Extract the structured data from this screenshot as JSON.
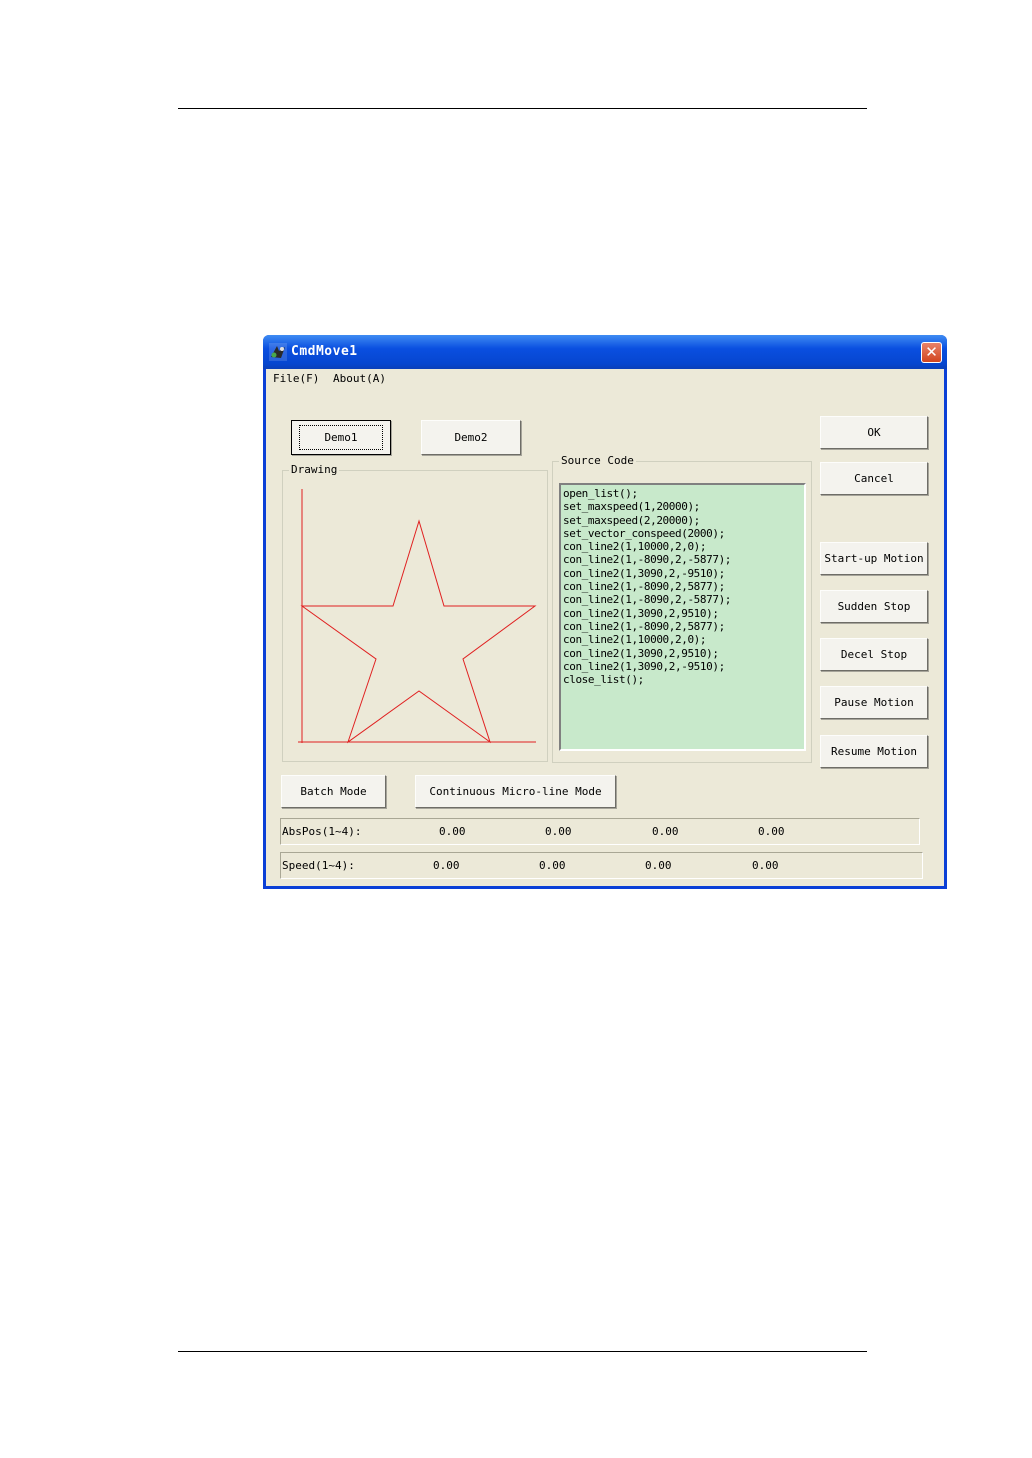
{
  "window": {
    "title": "CmdMove1",
    "close_glyph": "✕",
    "accent": "#0a4fe0"
  },
  "menu": [
    {
      "label": "File(F)"
    },
    {
      "label": "About(A)"
    }
  ],
  "buttons": {
    "demo1": "Demo1",
    "demo2": "Demo2",
    "ok": "OK",
    "cancel": "Cancel",
    "startup": "Start-up Motion",
    "sudden_stop": "Sudden Stop",
    "decel_stop": "Decel Stop",
    "pause": "Pause Motion",
    "resume": "Resume Motion",
    "batch": "Batch Mode",
    "continuous": "Continuous Micro-line Mode"
  },
  "drawing": {
    "label": "Drawing",
    "star_color": "#e02020",
    "axis_color": "#e02020"
  },
  "source_code": {
    "label": "Source Code",
    "background": "#c8e9cb",
    "lines": [
      "open_list();",
      "set_maxspeed(1,20000);",
      "set_maxspeed(2,20000);",
      "set_vector_conspeed(2000);",
      "con_line2(1,10000,2,0);",
      "con_line2(1,-8090,2,-5877);",
      "con_line2(1,3090,2,-9510);",
      "con_line2(1,-8090,2,5877);",
      "con_line2(1,-8090,2,-5877);",
      "con_line2(1,3090,2,9510);",
      "con_line2(1,-8090,2,5877);",
      "con_line2(1,10000,2,0);",
      "con_line2(1,3090,2,9510);",
      "con_line2(1,3090,2,-9510);",
      "close_list();"
    ]
  },
  "status": {
    "abspos": {
      "label": "AbsPos(1~4):",
      "values": [
        "0.00",
        "0.00",
        "0.00",
        "0.00"
      ]
    },
    "speed": {
      "label": "Speed(1~4):",
      "values": [
        "0.00",
        "0.00",
        "0.00",
        "0.00"
      ]
    }
  }
}
